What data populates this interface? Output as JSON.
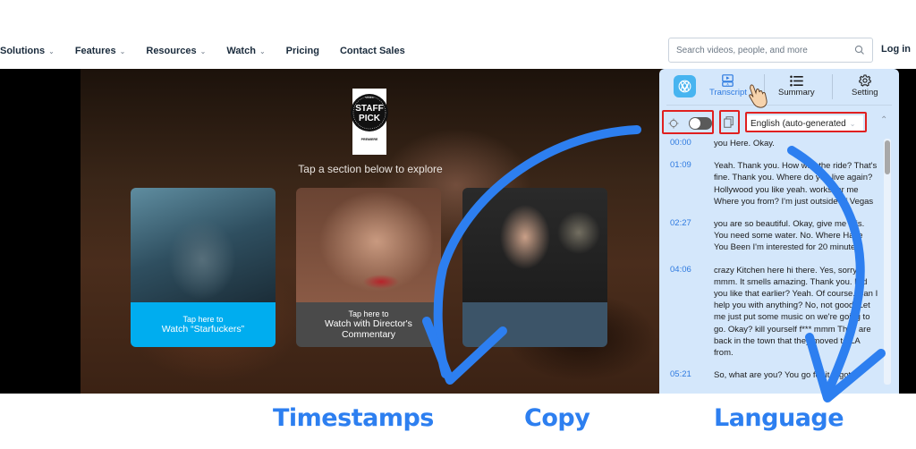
{
  "nav": {
    "items": [
      {
        "label": "Solutions",
        "has_dropdown": true
      },
      {
        "label": "Features",
        "has_dropdown": true
      },
      {
        "label": "Resources",
        "has_dropdown": true
      },
      {
        "label": "Watch",
        "has_dropdown": true
      },
      {
        "label": "Pricing",
        "has_dropdown": false
      },
      {
        "label": "Contact Sales",
        "has_dropdown": false
      }
    ],
    "chevron": "⌄",
    "search_placeholder": "Search videos, people, and more",
    "login_label": "Log in"
  },
  "video": {
    "badge": {
      "top": "vimeo",
      "line1": "STAFF",
      "line2": "PICK",
      "bottom": "PREMIERE"
    },
    "prompt": "Tap a section below to explore",
    "cards": [
      {
        "small": "Tap here to",
        "big": "Watch “Starfuckers”",
        "big2": "",
        "color": "#00adef"
      },
      {
        "small": "Tap here to",
        "big": "Watch with Director's",
        "big2": "Commentary",
        "color": "#4a4a4a"
      },
      {
        "small": "",
        "big": "",
        "big2": "",
        "color": "#3c5468"
      }
    ]
  },
  "panel": {
    "tabs": [
      {
        "label": "Transcript",
        "icon": "transcript-icon",
        "active": true
      },
      {
        "label": "Summary",
        "icon": "list-icon",
        "active": false
      },
      {
        "label": "Setting",
        "icon": "gear-icon",
        "active": false
      }
    ],
    "toolbar": {
      "toggle_on": false,
      "language": "English (auto-generated",
      "language_chevron": "⌄",
      "collapse_glyph": "⌃"
    },
    "transcript": [
      {
        "time": "00:00",
        "text": "you Here. Okay."
      },
      {
        "time": "01:09",
        "text": "Yeah. Thank you. How was the ride? That's fine. Thank you. Where do you live again? Hollywood you like yeah. works for me Where you from? I'm just outside of Vegas"
      },
      {
        "time": "02:27",
        "text": "you are so beautiful. Okay, give me this. You need some water. No. Where Have You Been I'm interested for 20 minutes"
      },
      {
        "time": "04:06",
        "text": "crazy Kitchen here hi there. Yes, sorry mmm. It smells amazing. Thank you. Did you like that earlier? Yeah. Of course. Can I help you with anything? No, not good. Let me just put some music on we're going to go. Okay? kill yourself f*** mmm They are back in the town that they moved to LA from."
      },
      {
        "time": "05:21",
        "text": "So, what are you? You go for it. I got"
      }
    ],
    "accent": "#2b79e0",
    "highlight_color": "#e02020"
  },
  "captions": {
    "timestamps": "Timestamps",
    "copy": "Copy",
    "language": "Language",
    "color": "#2d7ff0"
  }
}
